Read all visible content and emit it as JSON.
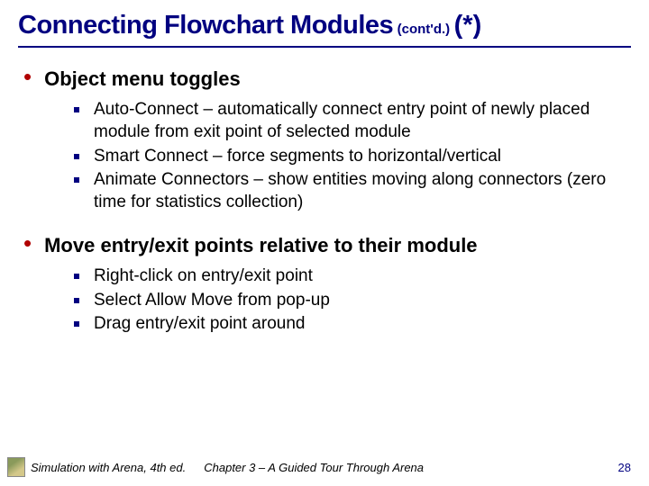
{
  "title_main": "Connecting Flowchart Modules",
  "title_cont": "(cont'd.)",
  "title_star": "(*)",
  "sections": [
    {
      "heading": "Object menu toggles",
      "items": [
        "Auto-Connect – automatically connect entry point of newly placed module from exit point of selected module",
        "Smart Connect – force segments to horizontal/vertical",
        "Animate Connectors – show entities moving along connectors (zero time for statistics collection)"
      ]
    },
    {
      "heading": "Move entry/exit points relative to their module",
      "items": [
        "Right-click on entry/exit point",
        "Select Allow Move from pop-up",
        "Drag entry/exit point around"
      ]
    }
  ],
  "footer": {
    "book": "Simulation with Arena, 4th ed.",
    "chapter": "Chapter 3 – A Guided Tour Through Arena",
    "page": "28"
  }
}
